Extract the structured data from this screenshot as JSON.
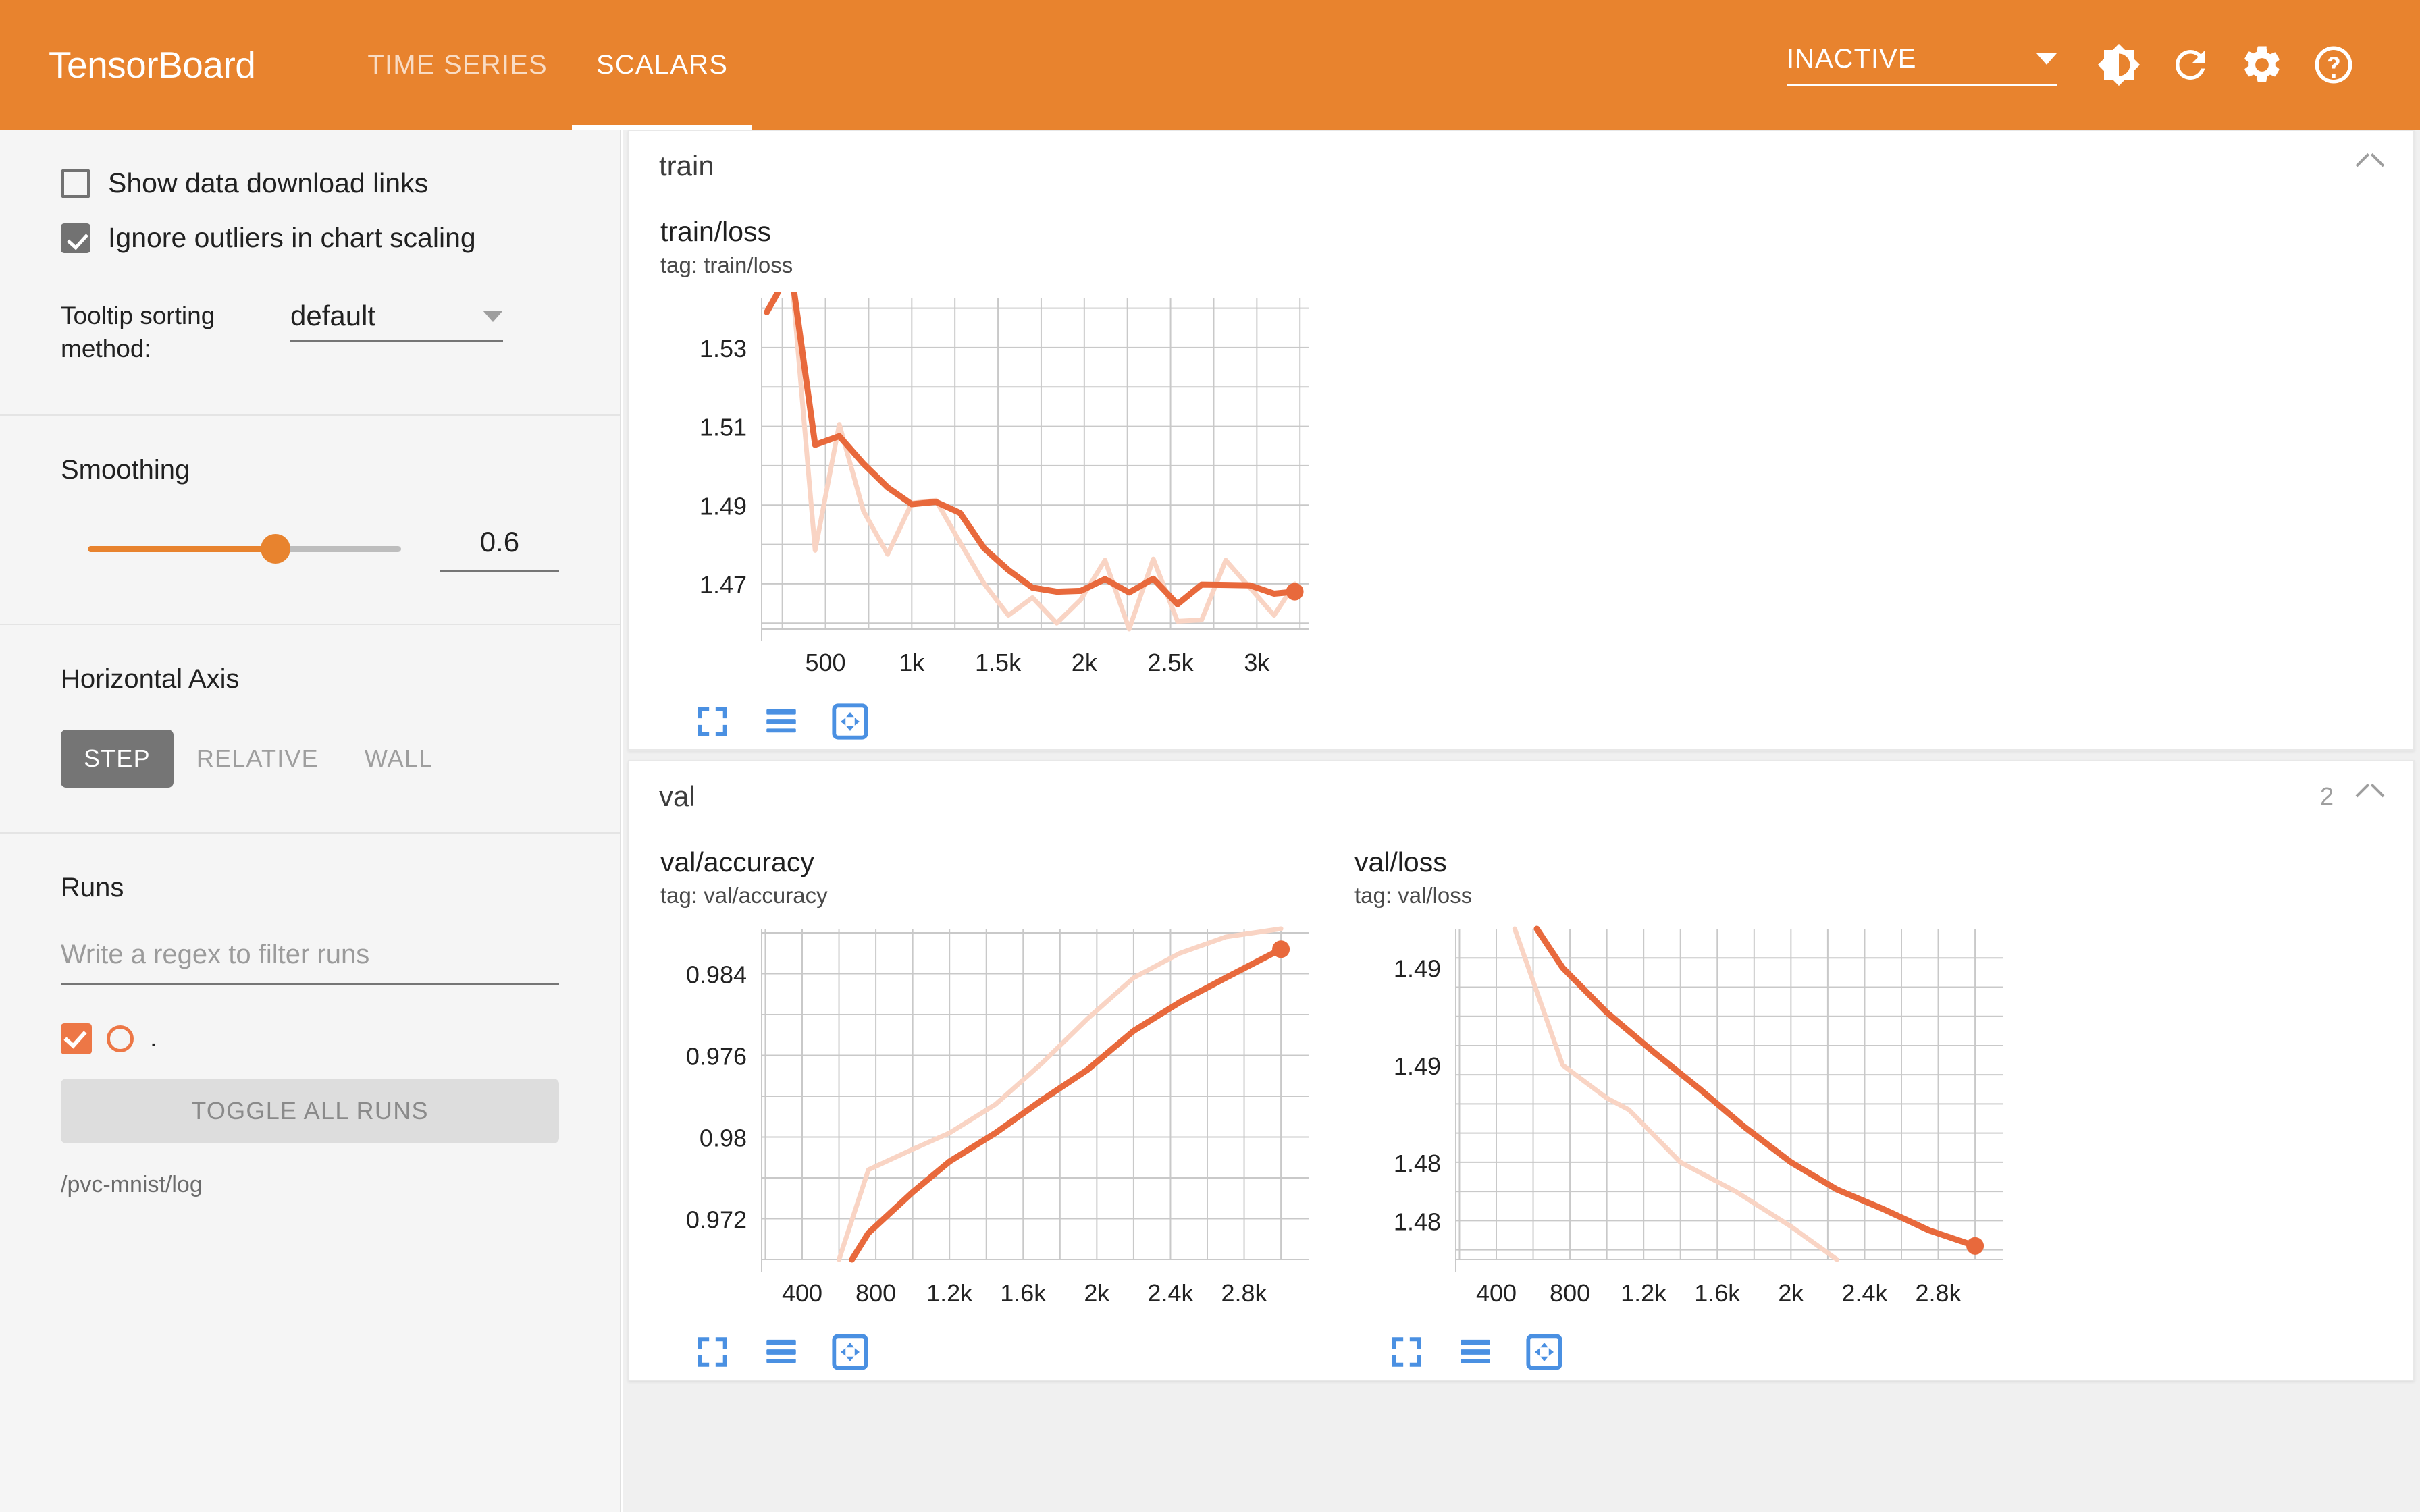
{
  "header": {
    "brand": "TensorBoard",
    "tabs": [
      {
        "label": "TIME SERIES",
        "active": false
      },
      {
        "label": "SCALARS",
        "active": true
      }
    ],
    "status": "INACTIVE",
    "icons": [
      "brightness-icon",
      "refresh-icon",
      "gear-icon",
      "help-icon"
    ]
  },
  "sidebar": {
    "show_download_links": {
      "label": "Show data download links",
      "checked": false
    },
    "ignore_outliers": {
      "label": "Ignore outliers in chart scaling",
      "checked": true
    },
    "tooltip_sorting": {
      "label": "Tooltip sorting method:",
      "value": "default"
    },
    "smoothing": {
      "label": "Smoothing",
      "value": "0.6",
      "fraction": 0.6
    },
    "horizontal_axis": {
      "label": "Horizontal Axis",
      "options": [
        "STEP",
        "RELATIVE",
        "WALL"
      ],
      "selected": "STEP"
    },
    "runs": {
      "label": "Runs",
      "filter_placeholder": "Write a regex to filter runs",
      "filter_value": "",
      "items": [
        {
          "name": ".",
          "checked": true,
          "color": "#ED7746"
        }
      ],
      "toggle_all_label": "TOGGLE ALL RUNS",
      "path": "/pvc-mnist/log"
    }
  },
  "main": {
    "groups": [
      {
        "name": "train",
        "count": "",
        "collapsed": false,
        "charts": [
          "train_loss"
        ]
      },
      {
        "name": "val",
        "count": "2",
        "collapsed": false,
        "charts": [
          "val_accuracy",
          "val_loss"
        ]
      }
    ],
    "chart_tools": [
      "fit-domain-icon",
      "toggle-y-axis-icon",
      "pan-icon"
    ]
  },
  "colors": {
    "brand_orange": "#E8832E",
    "series_line": "#E8693C",
    "series_raw": "#F9D4C4",
    "tool_blue": "#4A90E2",
    "grid": "#BDBDBD"
  },
  "chart_data": [
    {
      "id": "train_loss",
      "type": "line",
      "title": "train/loss",
      "subtitle": "tag: train/loss",
      "xlabel": "",
      "ylabel": "",
      "xlim": [
        130,
        3300
      ],
      "ylim": [
        1.4585,
        1.5425
      ],
      "xticks": [
        500,
        1000,
        1500,
        2000,
        2500,
        3000
      ],
      "xticklabels": [
        "500",
        "1k",
        "1.5k",
        "2k",
        "2.5k",
        "3k"
      ],
      "yticks": [
        1.47,
        1.49,
        1.51,
        1.53
      ],
      "yticklabels": [
        "1.47",
        "1.49",
        "1.51",
        "1.53"
      ],
      "grid": true,
      "legend": "none",
      "series": [
        {
          "name": "smoothed",
          "color": "#E8693C",
          "width": 9,
          "end_marker": true,
          "x": [
            160,
            300,
            440,
            580,
            720,
            860,
            1000,
            1140,
            1280,
            1420,
            1560,
            1700,
            1840,
            1980,
            2120,
            2260,
            2400,
            2540,
            2680,
            2820,
            2960,
            3100,
            3220
          ],
          "y": [
            1.539,
            1.55,
            1.5053,
            1.5075,
            1.5005,
            1.4945,
            1.4902,
            1.4908,
            1.488,
            1.479,
            1.4735,
            1.469,
            1.468,
            1.4682,
            1.4712,
            1.4678,
            1.4713,
            1.4648,
            1.4698,
            1.4697,
            1.4696,
            1.4675,
            1.468
          ]
        },
        {
          "name": "raw",
          "color": "#F9D4C4",
          "width": 7,
          "end_marker": false,
          "x": [
            300,
            440,
            580,
            720,
            860,
            1000,
            1140,
            1280,
            1420,
            1560,
            1700,
            1840,
            1980,
            2120,
            2260,
            2400,
            2540,
            2680,
            2820,
            2960,
            3100,
            3220
          ],
          "y": [
            1.55,
            1.4785,
            1.5105,
            1.4885,
            1.4775,
            1.4905,
            1.4912,
            1.4805,
            1.47,
            1.462,
            1.4665,
            1.46,
            1.466,
            1.476,
            1.4585,
            1.4763,
            1.4605,
            1.4608,
            1.476,
            1.469,
            1.462,
            1.47
          ]
        }
      ]
    },
    {
      "id": "val_accuracy",
      "type": "line",
      "title": "val/accuracy",
      "subtitle": "tag: val/accuracy",
      "xlabel": "",
      "ylabel": "",
      "xlim": [
        180,
        3150
      ],
      "ylim": [
        0.97,
        0.9862
      ],
      "xticks": [
        400,
        800,
        1200,
        1600,
        2000,
        2400,
        2800
      ],
      "xticklabels": [
        "400",
        "800",
        "1.2k",
        "1.6k",
        "2k",
        "2.4k",
        "2.8k"
      ],
      "yticks": [
        0.972,
        0.976,
        0.98,
        0.984
      ],
      "yticklabels": [
        "0.972",
        "0.98",
        "0.976",
        "0.984"
      ],
      "grid": true,
      "legend": "none",
      "series": [
        {
          "name": "smoothed",
          "color": "#E8693C",
          "width": 9,
          "end_marker": true,
          "x": [
            670,
            760,
            1000,
            1200,
            1450,
            1700,
            1950,
            2200,
            2450,
            2700,
            3000
          ],
          "y": [
            0.97,
            0.9713,
            0.9733,
            0.9748,
            0.9762,
            0.9778,
            0.9793,
            0.9812,
            0.9826,
            0.9838,
            0.9852
          ]
        },
        {
          "name": "raw",
          "color": "#F9D4C4",
          "width": 7,
          "end_marker": false,
          "x": [
            600,
            760,
            1000,
            1200,
            1450,
            1700,
            1950,
            2200,
            2450,
            2700,
            3000
          ],
          "y": [
            0.97,
            0.9744,
            0.9754,
            0.9762,
            0.9776,
            0.9796,
            0.9818,
            0.9838,
            0.985,
            0.9858,
            0.9862
          ]
        }
      ]
    },
    {
      "id": "val_loss",
      "type": "line",
      "title": "val/loss",
      "subtitle": "tag: val/loss",
      "xlabel": "",
      "ylabel": "",
      "xlim": [
        180,
        3150
      ],
      "ylim": [
        1.4755,
        1.4925
      ],
      "xticks": [
        400,
        800,
        1200,
        1600,
        2000,
        2400,
        2800
      ],
      "xticklabels": [
        "400",
        "800",
        "1.2k",
        "1.6k",
        "2k",
        "2.4k",
        "2.8k"
      ],
      "yticks": [
        1.4775,
        1.4805,
        1.4855,
        1.4905
      ],
      "yticklabels": [
        "1.48",
        "1.48",
        "1.49",
        "1.49"
      ],
      "grid": true,
      "legend": "none",
      "series": [
        {
          "name": "smoothed",
          "color": "#E8693C",
          "width": 9,
          "end_marker": true,
          "x": [
            620,
            760,
            1000,
            1250,
            1500,
            1750,
            2000,
            2250,
            2500,
            2750,
            3000
          ],
          "y": [
            1.4925,
            1.4905,
            1.4882,
            1.4862,
            1.4843,
            1.4823,
            1.4805,
            1.4791,
            1.4781,
            1.477,
            1.4762
          ]
        },
        {
          "name": "raw",
          "color": "#F9D4C4",
          "width": 7,
          "end_marker": false,
          "x": [
            500,
            760,
            1000,
            1120,
            1400,
            1700,
            2000,
            2250
          ],
          "y": [
            1.4925,
            1.4855,
            1.4838,
            1.4832,
            1.4805,
            1.479,
            1.4772,
            1.4755
          ]
        }
      ]
    }
  ]
}
